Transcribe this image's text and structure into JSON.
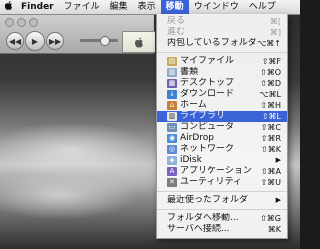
{
  "menubar": {
    "apple_icon": "apple-logo-icon",
    "items": [
      {
        "label": "Finder",
        "bold": true
      },
      {
        "label": "ファイル"
      },
      {
        "label": "編集"
      },
      {
        "label": "表示"
      },
      {
        "label": "移動",
        "active": true
      },
      {
        "label": "ウインドウ"
      },
      {
        "label": "ヘルプ"
      }
    ]
  },
  "itunes": {
    "prev_icon": "rewind-icon",
    "play_icon": "play-icon",
    "next_icon": "fast-forward-icon",
    "lcd_icon": "apple-logo-icon",
    "volume_fraction": 0.6
  },
  "go_menu": {
    "items": [
      {
        "type": "item",
        "label": "戻る",
        "shortcut": "⌘[",
        "disabled": true
      },
      {
        "type": "item",
        "label": "進む",
        "shortcut": "⌘]",
        "disabled": true
      },
      {
        "type": "item",
        "label": "内包しているフォルダ",
        "shortcut": "⌥⌘↑"
      },
      {
        "type": "sep"
      },
      {
        "type": "item",
        "label": "マイファイル",
        "shortcut": "⇧⌘F",
        "icon": "all-my-files-icon",
        "color": "#c9a65a"
      },
      {
        "type": "item",
        "label": "書類",
        "shortcut": "⇧⌘O",
        "icon": "documents-icon",
        "color": "#8fa8c4"
      },
      {
        "type": "item",
        "label": "デスクトップ",
        "shortcut": "⇧⌘D",
        "icon": "desktop-icon",
        "color": "#6f5fb0"
      },
      {
        "type": "item",
        "label": "ダウンロード",
        "shortcut": "⌥⌘L",
        "icon": "downloads-icon",
        "color": "#3d7fd1"
      },
      {
        "type": "item",
        "label": "ホーム",
        "shortcut": "⇧⌘H",
        "icon": "home-icon",
        "color": "#c77f3a"
      },
      {
        "type": "item",
        "label": "ライブラリ",
        "shortcut": "⇧⌘L",
        "icon": "library-icon",
        "color": "#e8e8e8",
        "highlight": true
      },
      {
        "type": "item",
        "label": "コンピュータ",
        "shortcut": "⇧⌘C",
        "icon": "computer-icon",
        "color": "#6d8fb5"
      },
      {
        "type": "item",
        "label": "AirDrop",
        "shortcut": "⇧⌘R",
        "icon": "airdrop-icon",
        "color": "#4a8fd6"
      },
      {
        "type": "item",
        "label": "ネットワーク",
        "shortcut": "⇧⌘K",
        "icon": "network-icon",
        "color": "#5b8ad0"
      },
      {
        "type": "item",
        "label": "iDisk",
        "shortcut": "",
        "icon": "idisk-icon",
        "color": "#8fb0d8",
        "submenu": true
      },
      {
        "type": "item",
        "label": "アプリケーション",
        "shortcut": "⇧⌘A",
        "icon": "applications-icon",
        "color": "#7b5fc0"
      },
      {
        "type": "item",
        "label": "ユーティリティ",
        "shortcut": "⇧⌘U",
        "icon": "utilities-icon",
        "color": "#7c7c7c"
      },
      {
        "type": "sep"
      },
      {
        "type": "item",
        "label": "最近使ったフォルダ",
        "shortcut": "",
        "submenu": true
      },
      {
        "type": "sep"
      },
      {
        "type": "item",
        "label": "フォルダへ移動...",
        "shortcut": "⇧⌘G"
      },
      {
        "type": "item",
        "label": "サーバへ接続...",
        "shortcut": "⌘K"
      }
    ]
  },
  "colors": {
    "highlight": "#3b63d8",
    "menubar_bg": "#e6e6e6"
  }
}
